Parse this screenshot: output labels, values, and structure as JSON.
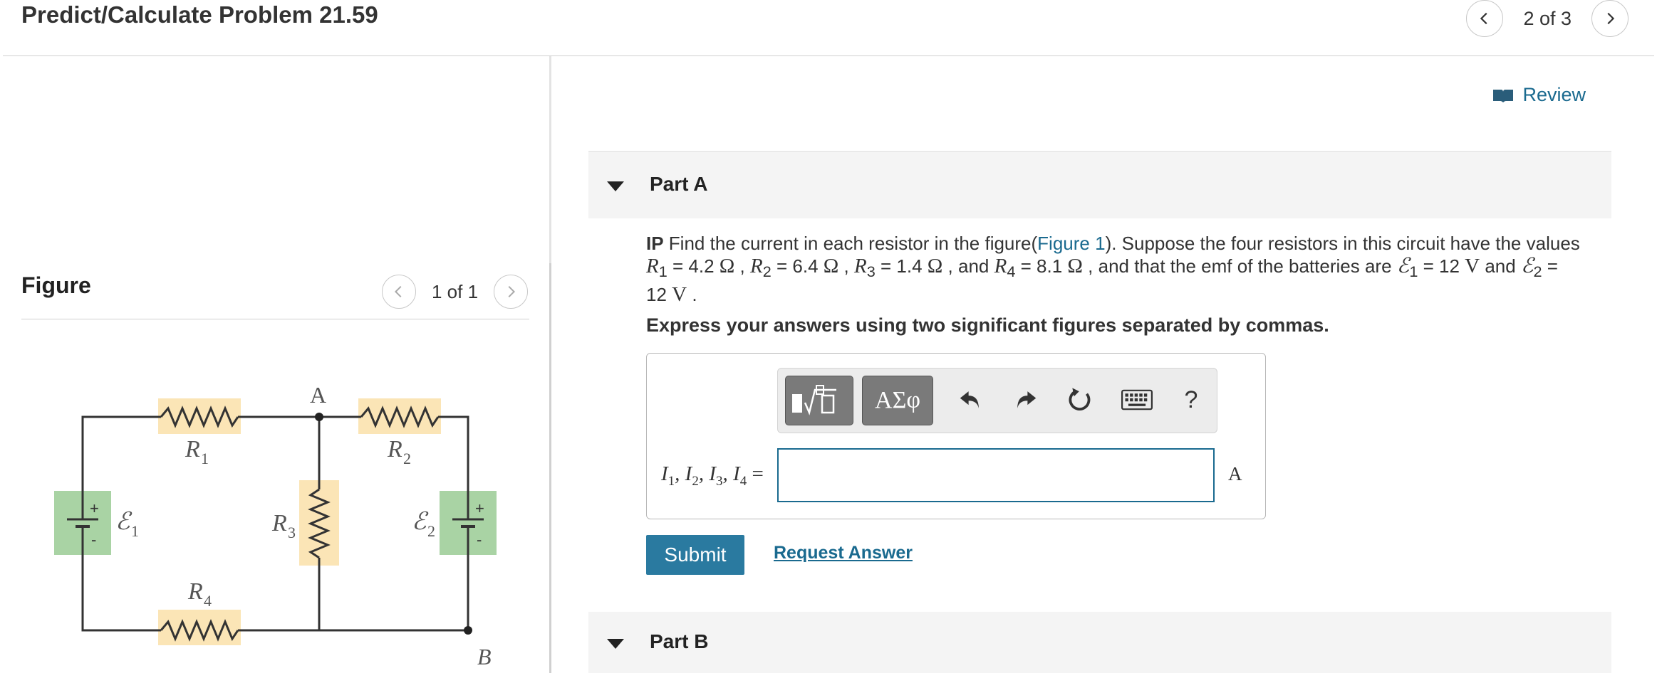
{
  "header": {
    "title": "Predict/Calculate Problem 21.59",
    "page_count": "2 of 3"
  },
  "review": {
    "label": "Review"
  },
  "figure": {
    "label": "Figure",
    "page_count": "1 of 1",
    "labels": {
      "A": "A",
      "B": "B",
      "R1": "R",
      "R1_sub": "1",
      "R2": "R",
      "R2_sub": "2",
      "R3": "R",
      "R3_sub": "3",
      "R4": "R",
      "R4_sub": "4",
      "E1": "ℰ",
      "E1_sub": "1",
      "E2": "ℰ",
      "E2_sub": "2",
      "plus": "+",
      "minus": "-"
    }
  },
  "partA": {
    "title": "Part A",
    "question": {
      "ip": "IP",
      "t1": " Find the current in each resistor in the figure(",
      "link": "Figure 1",
      "t2": "). Suppose the four resistors in this circuit have the values ",
      "r1": "R",
      "r1s": "1",
      "v1": " = 4.2 ",
      "r2": "R",
      "r2s": "2",
      "v2": " = 6.4 ",
      "r3": "R",
      "r3s": "3",
      "v3": " = 1.4 ",
      "and": " and ",
      "r4": "R",
      "r4s": "4",
      "v4": " = 8.1 ",
      "t3": " and that the emf of the batteries are ",
      "e1": "ℰ",
      "e1s": "1",
      "ev1": " = 12 ",
      "and2": " and ",
      "e2": "ℰ",
      "e2s": "2",
      "ev2": " = ",
      "ev2b": "12 ",
      "ohm": "Ω",
      "volt": "V",
      "comma": " , ",
      "period": " ."
    },
    "instruction": "Express your answers using two significant figures separated by commas.",
    "toolbar": {
      "templates_label": "√",
      "symbols_label": "ΑΣφ",
      "help_label": "?"
    },
    "answer": {
      "I": "I",
      "s1": "1",
      "s2": "2",
      "s3": "3",
      "s4": "4",
      "sep": ", ",
      "eq": " =",
      "value": "",
      "unit": "A"
    },
    "submit_label": "Submit",
    "request_label": "Request Answer"
  },
  "partB": {
    "title": "Part B"
  },
  "colors": {
    "link": "#1a6a8f",
    "submit": "#2a7aa0",
    "resistor_highlight": "#fbe5b6",
    "battery_highlight": "#a9d3a4"
  }
}
